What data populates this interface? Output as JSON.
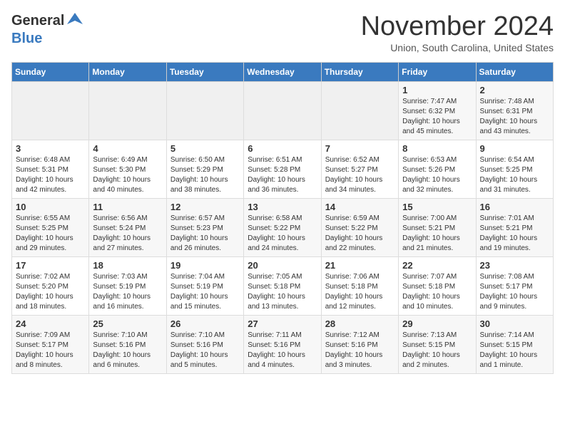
{
  "header": {
    "logo_general": "General",
    "logo_blue": "Blue",
    "month_title": "November 2024",
    "location": "Union, South Carolina, United States"
  },
  "calendar": {
    "days_of_week": [
      "Sunday",
      "Monday",
      "Tuesday",
      "Wednesday",
      "Thursday",
      "Friday",
      "Saturday"
    ],
    "weeks": [
      [
        {
          "day": "",
          "info": ""
        },
        {
          "day": "",
          "info": ""
        },
        {
          "day": "",
          "info": ""
        },
        {
          "day": "",
          "info": ""
        },
        {
          "day": "",
          "info": ""
        },
        {
          "day": "1",
          "info": "Sunrise: 7:47 AM\nSunset: 6:32 PM\nDaylight: 10 hours and 45 minutes."
        },
        {
          "day": "2",
          "info": "Sunrise: 7:48 AM\nSunset: 6:31 PM\nDaylight: 10 hours and 43 minutes."
        }
      ],
      [
        {
          "day": "3",
          "info": "Sunrise: 6:48 AM\nSunset: 5:31 PM\nDaylight: 10 hours and 42 minutes."
        },
        {
          "day": "4",
          "info": "Sunrise: 6:49 AM\nSunset: 5:30 PM\nDaylight: 10 hours and 40 minutes."
        },
        {
          "day": "5",
          "info": "Sunrise: 6:50 AM\nSunset: 5:29 PM\nDaylight: 10 hours and 38 minutes."
        },
        {
          "day": "6",
          "info": "Sunrise: 6:51 AM\nSunset: 5:28 PM\nDaylight: 10 hours and 36 minutes."
        },
        {
          "day": "7",
          "info": "Sunrise: 6:52 AM\nSunset: 5:27 PM\nDaylight: 10 hours and 34 minutes."
        },
        {
          "day": "8",
          "info": "Sunrise: 6:53 AM\nSunset: 5:26 PM\nDaylight: 10 hours and 32 minutes."
        },
        {
          "day": "9",
          "info": "Sunrise: 6:54 AM\nSunset: 5:25 PM\nDaylight: 10 hours and 31 minutes."
        }
      ],
      [
        {
          "day": "10",
          "info": "Sunrise: 6:55 AM\nSunset: 5:25 PM\nDaylight: 10 hours and 29 minutes."
        },
        {
          "day": "11",
          "info": "Sunrise: 6:56 AM\nSunset: 5:24 PM\nDaylight: 10 hours and 27 minutes."
        },
        {
          "day": "12",
          "info": "Sunrise: 6:57 AM\nSunset: 5:23 PM\nDaylight: 10 hours and 26 minutes."
        },
        {
          "day": "13",
          "info": "Sunrise: 6:58 AM\nSunset: 5:22 PM\nDaylight: 10 hours and 24 minutes."
        },
        {
          "day": "14",
          "info": "Sunrise: 6:59 AM\nSunset: 5:22 PM\nDaylight: 10 hours and 22 minutes."
        },
        {
          "day": "15",
          "info": "Sunrise: 7:00 AM\nSunset: 5:21 PM\nDaylight: 10 hours and 21 minutes."
        },
        {
          "day": "16",
          "info": "Sunrise: 7:01 AM\nSunset: 5:21 PM\nDaylight: 10 hours and 19 minutes."
        }
      ],
      [
        {
          "day": "17",
          "info": "Sunrise: 7:02 AM\nSunset: 5:20 PM\nDaylight: 10 hours and 18 minutes."
        },
        {
          "day": "18",
          "info": "Sunrise: 7:03 AM\nSunset: 5:19 PM\nDaylight: 10 hours and 16 minutes."
        },
        {
          "day": "19",
          "info": "Sunrise: 7:04 AM\nSunset: 5:19 PM\nDaylight: 10 hours and 15 minutes."
        },
        {
          "day": "20",
          "info": "Sunrise: 7:05 AM\nSunset: 5:18 PM\nDaylight: 10 hours and 13 minutes."
        },
        {
          "day": "21",
          "info": "Sunrise: 7:06 AM\nSunset: 5:18 PM\nDaylight: 10 hours and 12 minutes."
        },
        {
          "day": "22",
          "info": "Sunrise: 7:07 AM\nSunset: 5:18 PM\nDaylight: 10 hours and 10 minutes."
        },
        {
          "day": "23",
          "info": "Sunrise: 7:08 AM\nSunset: 5:17 PM\nDaylight: 10 hours and 9 minutes."
        }
      ],
      [
        {
          "day": "24",
          "info": "Sunrise: 7:09 AM\nSunset: 5:17 PM\nDaylight: 10 hours and 8 minutes."
        },
        {
          "day": "25",
          "info": "Sunrise: 7:10 AM\nSunset: 5:16 PM\nDaylight: 10 hours and 6 minutes."
        },
        {
          "day": "26",
          "info": "Sunrise: 7:10 AM\nSunset: 5:16 PM\nDaylight: 10 hours and 5 minutes."
        },
        {
          "day": "27",
          "info": "Sunrise: 7:11 AM\nSunset: 5:16 PM\nDaylight: 10 hours and 4 minutes."
        },
        {
          "day": "28",
          "info": "Sunrise: 7:12 AM\nSunset: 5:16 PM\nDaylight: 10 hours and 3 minutes."
        },
        {
          "day": "29",
          "info": "Sunrise: 7:13 AM\nSunset: 5:15 PM\nDaylight: 10 hours and 2 minutes."
        },
        {
          "day": "30",
          "info": "Sunrise: 7:14 AM\nSunset: 5:15 PM\nDaylight: 10 hours and 1 minute."
        }
      ]
    ]
  }
}
